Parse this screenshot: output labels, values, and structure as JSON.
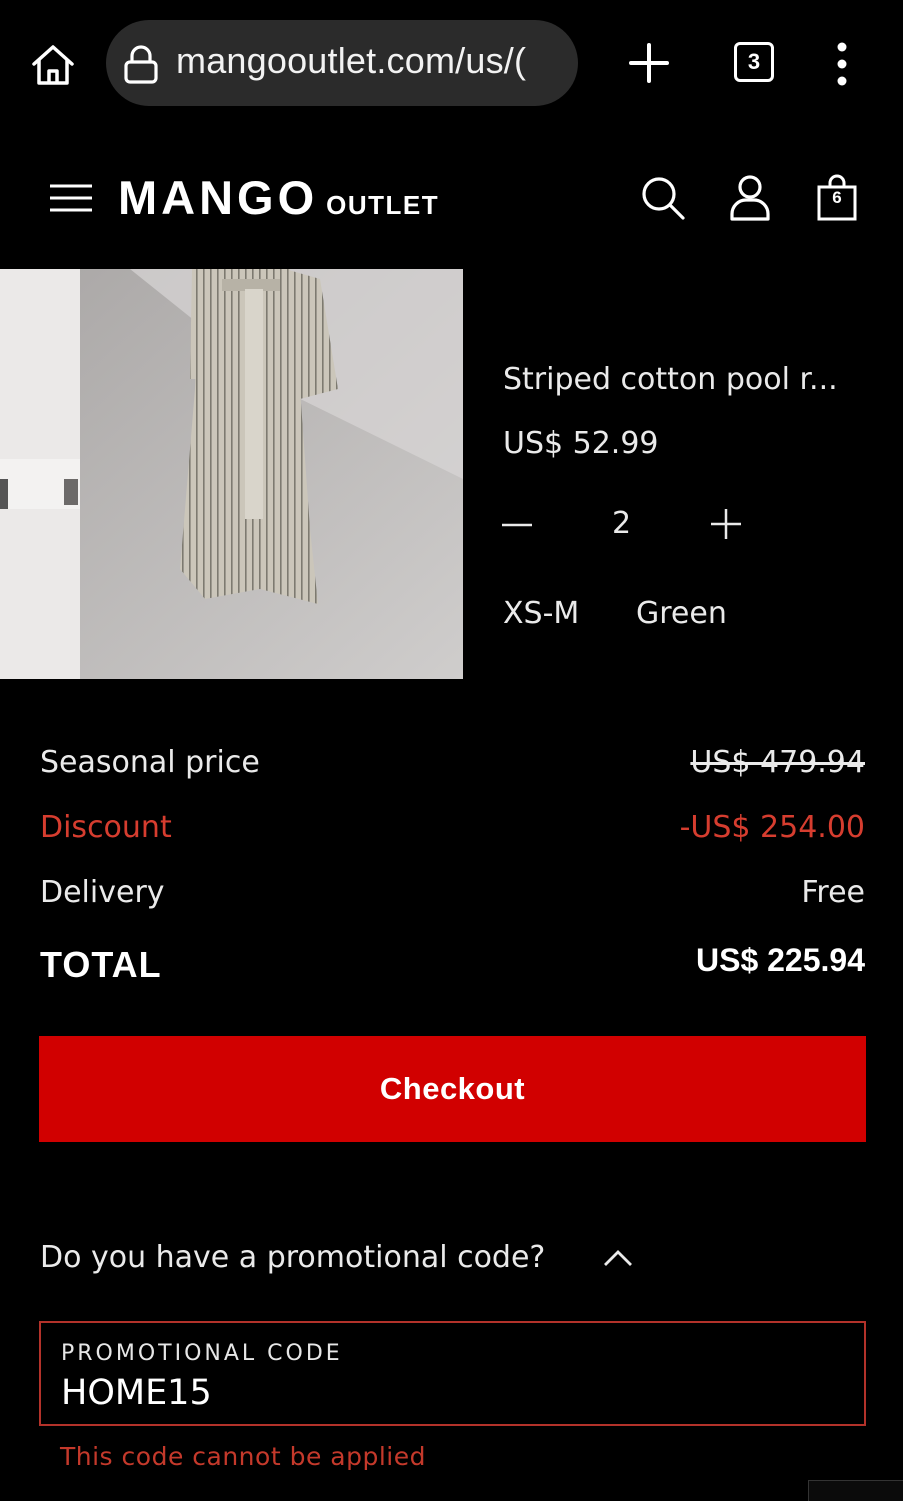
{
  "browser": {
    "url": "mangooutlet.com/us/(",
    "tab_count": "3"
  },
  "header": {
    "logo_main": "MANGO",
    "logo_sub": "OUTLET",
    "bag_count": "6"
  },
  "product": {
    "name": "Striped cotton pool r...",
    "price": "US$ 52.99",
    "quantity": "2",
    "size": "XS-M",
    "color": "Green"
  },
  "summary": {
    "seasonal_label": "Seasonal price",
    "seasonal_value": "US$ 479.94",
    "discount_label": "Discount",
    "discount_value": "-US$ 254.00",
    "delivery_label": "Delivery",
    "delivery_value": "Free",
    "total_label": "TOTAL",
    "total_value": "US$ 225.94"
  },
  "checkout_label": "Checkout",
  "promo": {
    "question": "Do you have a promotional code?",
    "field_label": "PROMOTIONAL CODE",
    "value": "HOME15",
    "error": "This code cannot be applied"
  },
  "colors": {
    "accent": "#d10000",
    "error": "#c4392b"
  }
}
